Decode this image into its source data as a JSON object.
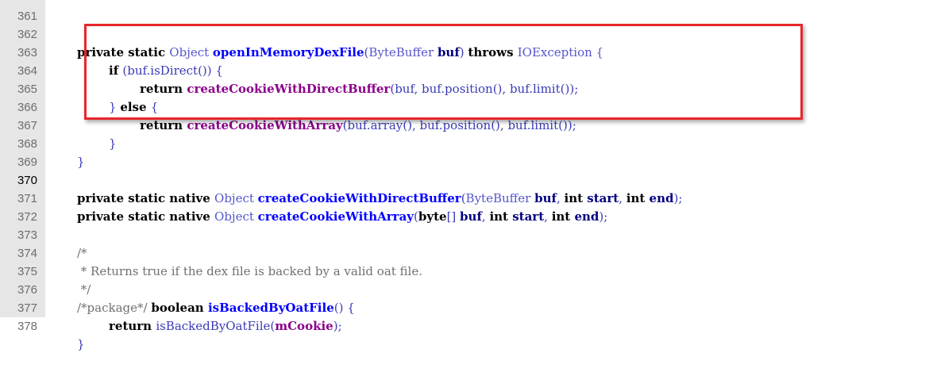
{
  "line_numbers": [
    "361",
    "362",
    "363",
    "364",
    "365",
    "366",
    "367",
    "368",
    "369",
    "370",
    "371",
    "372",
    "373",
    "374",
    "375",
    "376",
    "377",
    "378"
  ],
  "code": {
    "l362": {
      "k1": "private static ",
      "t1": "Object ",
      "f1": "openInMemoryDexFile",
      "p1": "(",
      "t2": "ByteBuffer ",
      "v1": "buf",
      "p2": ") ",
      "k2": "throws ",
      "t3": "IOException {"
    },
    "l363": {
      "k1": "if ",
      "p1": "(buf.isDirect()) {"
    },
    "l364": {
      "k1": "return ",
      "f1": "createCookieWithDirectBuffer",
      "p1": "(buf, buf.position(), buf.limit());"
    },
    "l365": {
      "p1": "} ",
      "k1": "else ",
      "p2": "{"
    },
    "l366": {
      "k1": "return ",
      "f1": "createCookieWithArray",
      "p1": "(buf.array(), buf.position(), buf.limit());"
    },
    "l367": {
      "p1": "}"
    },
    "l368": {
      "p1": "}"
    },
    "l370": {
      "k1": "private static native ",
      "t1": "Object ",
      "f1": "createCookieWithDirectBuffer",
      "p1": "(",
      "t2": "ByteBuffer ",
      "v1": "buf",
      "p2": ", ",
      "k2": "int ",
      "v2": "start",
      "p3": ", ",
      "k3": "int ",
      "v3": "end",
      "p4": ");"
    },
    "l371": {
      "k1": "private static native ",
      "t1": "Object ",
      "f1": "createCookieWithArray",
      "p1": "(",
      "k2": "byte",
      "p2": "[] ",
      "v1": "buf",
      "p3": ", ",
      "k3": "int ",
      "v2": "start",
      "p4": ", ",
      "k4": "int ",
      "v3": "end",
      "p5": ");"
    },
    "l373": {
      "c1": "/*"
    },
    "l374": {
      "c1": " * Returns true if the dex file is backed by a valid oat file."
    },
    "l375": {
      "c1": " */"
    },
    "l376": {
      "c1": "/*package*/ ",
      "k1": "boolean ",
      "f1": "isBackedByOatFile",
      "p1": "() {"
    },
    "l377": {
      "k1": "return ",
      "p1": "isBackedByOatFile(",
      "v1": "mCookie",
      "p2": ");"
    },
    "l378": {
      "p1": "}"
    }
  },
  "colors": {
    "highlight_border": "#e8262c",
    "gutter_bg": "#e6e6e6",
    "keyword": "#000000",
    "method_decl": "#0000ff",
    "method_call": "#8b008b",
    "plain": "#3a3ab8"
  }
}
